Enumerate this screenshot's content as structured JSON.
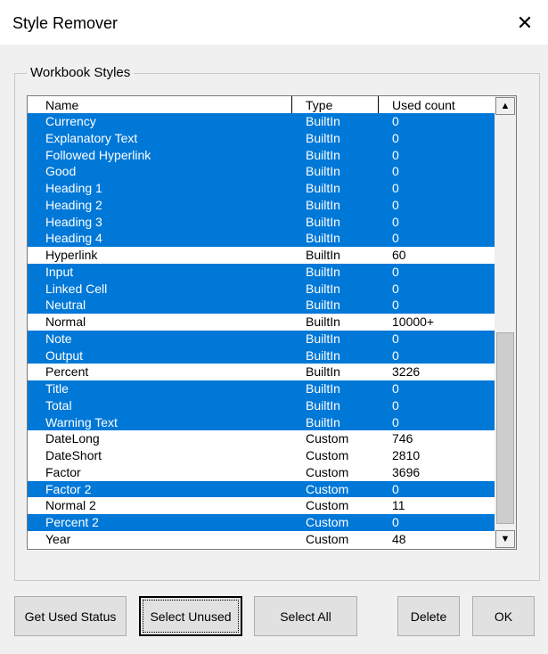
{
  "window": {
    "title": "Style Remover",
    "close_glyph": "✕"
  },
  "group": {
    "label": "Workbook Styles"
  },
  "list": {
    "columns": [
      "Name",
      "Type",
      "Used count"
    ],
    "rows": [
      {
        "name": "Currency",
        "type": "BuiltIn",
        "used": "0",
        "selected": true
      },
      {
        "name": "Explanatory Text",
        "type": "BuiltIn",
        "used": "0",
        "selected": true
      },
      {
        "name": "Followed Hyperlink",
        "type": "BuiltIn",
        "used": "0",
        "selected": true
      },
      {
        "name": "Good",
        "type": "BuiltIn",
        "used": "0",
        "selected": true
      },
      {
        "name": "Heading 1",
        "type": "BuiltIn",
        "used": "0",
        "selected": true
      },
      {
        "name": "Heading 2",
        "type": "BuiltIn",
        "used": "0",
        "selected": true
      },
      {
        "name": "Heading 3",
        "type": "BuiltIn",
        "used": "0",
        "selected": true
      },
      {
        "name": "Heading 4",
        "type": "BuiltIn",
        "used": "0",
        "selected": true
      },
      {
        "name": "Hyperlink",
        "type": "BuiltIn",
        "used": "60",
        "selected": false
      },
      {
        "name": "Input",
        "type": "BuiltIn",
        "used": "0",
        "selected": true
      },
      {
        "name": "Linked Cell",
        "type": "BuiltIn",
        "used": "0",
        "selected": true
      },
      {
        "name": "Neutral",
        "type": "BuiltIn",
        "used": "0",
        "selected": true
      },
      {
        "name": "Normal",
        "type": "BuiltIn",
        "used": "10000+",
        "selected": false
      },
      {
        "name": "Note",
        "type": "BuiltIn",
        "used": "0",
        "selected": true
      },
      {
        "name": "Output",
        "type": "BuiltIn",
        "used": "0",
        "selected": true
      },
      {
        "name": "Percent",
        "type": "BuiltIn",
        "used": "3226",
        "selected": false
      },
      {
        "name": "Title",
        "type": "BuiltIn",
        "used": "0",
        "selected": true
      },
      {
        "name": "Total",
        "type": "BuiltIn",
        "used": "0",
        "selected": true
      },
      {
        "name": "Warning Text",
        "type": "BuiltIn",
        "used": "0",
        "selected": true
      },
      {
        "name": "DateLong",
        "type": "Custom",
        "used": "746",
        "selected": false
      },
      {
        "name": "DateShort",
        "type": "Custom",
        "used": "2810",
        "selected": false
      },
      {
        "name": "Factor",
        "type": "Custom",
        "used": "3696",
        "selected": false
      },
      {
        "name": "Factor 2",
        "type": "Custom",
        "used": "0",
        "selected": true
      },
      {
        "name": "Normal 2",
        "type": "Custom",
        "used": "11",
        "selected": false
      },
      {
        "name": "Percent 2",
        "type": "Custom",
        "used": "0",
        "selected": true
      },
      {
        "name": "Year",
        "type": "Custom",
        "used": "48",
        "selected": false
      }
    ],
    "scroll_up_glyph": "▲",
    "scroll_down_glyph": "▼"
  },
  "buttons": {
    "get_used_status": "Get Used Status",
    "select_unused": "Select Unused",
    "select_all": "Select All",
    "delete": "Delete",
    "ok": "OK"
  },
  "colors": {
    "selection": "#0078d7",
    "selection_text": "#ffffff",
    "dialog_bg": "#f0f0f0"
  }
}
